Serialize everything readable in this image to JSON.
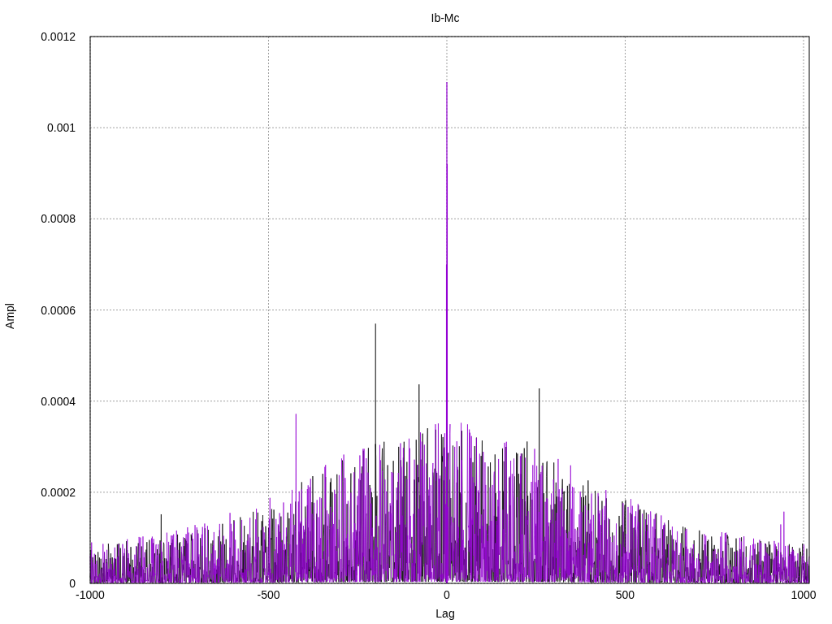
{
  "title": "Ib-Mc",
  "xlabel": "Lag",
  "ylabel": "Ampl",
  "xticks": [
    "-1000",
    "-500",
    "0",
    "500",
    "1000"
  ],
  "yticks": [
    "0.0012",
    "0.001",
    "0.0008",
    "0.0006",
    "0.0004",
    "0.0002",
    "0"
  ]
}
